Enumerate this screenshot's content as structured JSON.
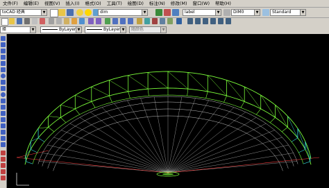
{
  "menubar": {
    "items": [
      "文件(F)",
      "编辑(E)",
      "视图(V)",
      "插入(I)",
      "格式(O)",
      "工具(T)",
      "绘图(D)",
      "标注(N)",
      "修改(M)",
      "窗口(W)",
      "帮助(H)"
    ]
  },
  "toolbar1": {
    "workspace_value": "toCAD 经典",
    "layer_value": "dim",
    "text_style_value": "label",
    "dim_style_value": "DIM0",
    "table_style_value": "Standard"
  },
  "toolbar2": {
    "layer_combo_value": "择",
    "linetype_value": "ByLayer",
    "lineweight_value": "ByLayer",
    "plotstyle_value": "随颜色"
  },
  "colors": {
    "structure_green": "#7cff3a",
    "structure_cyan": "#33d6e0",
    "guide_white": "#e6e6e6",
    "guide_red": "#ff4040",
    "background": "#000000",
    "chrome": "#d4d0c8"
  }
}
